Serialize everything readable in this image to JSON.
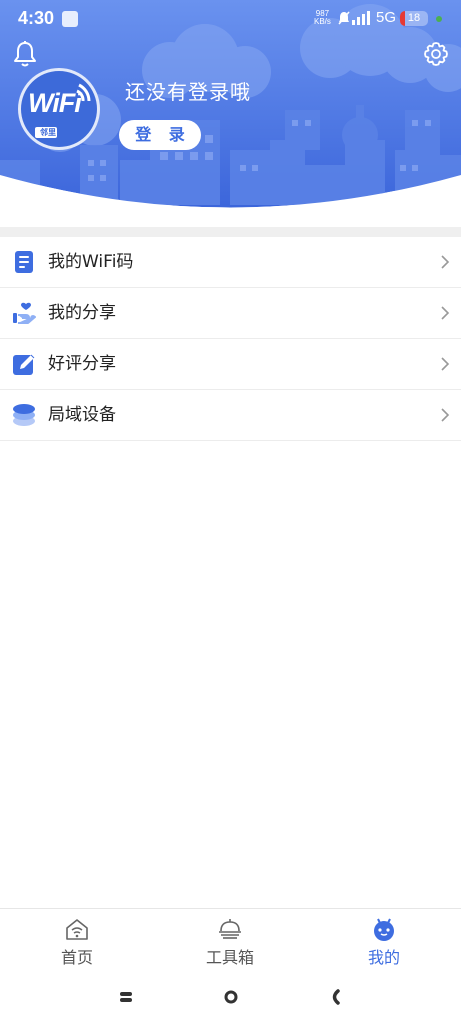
{
  "status_bar": {
    "time": "4:30",
    "speed_value": "987",
    "speed_unit": "KB/s",
    "network": "5G",
    "battery": "18",
    "battery_level": 0.18
  },
  "profile": {
    "logo_text": "WiFi",
    "logo_sub": "邻里",
    "prompt": "还没有登录哦",
    "login_label": "登 录"
  },
  "menu": {
    "items": [
      {
        "label": "我的WiFi码",
        "icon": "document-icon"
      },
      {
        "label": "我的分享",
        "icon": "hand-heart-icon"
      },
      {
        "label": "好评分享",
        "icon": "edit-icon"
      },
      {
        "label": "局域设备",
        "icon": "layers-icon"
      }
    ]
  },
  "tabbar": {
    "tabs": [
      {
        "label": "首页",
        "icon": "home-wifi-icon",
        "active": false
      },
      {
        "label": "工具箱",
        "icon": "toolbox-icon",
        "active": false
      },
      {
        "label": "我的",
        "icon": "robot-icon",
        "active": true
      }
    ]
  },
  "colors": {
    "accent": "#3e6de0",
    "header_gradient_top": "#5b86ea",
    "header_gradient_bottom": "#3d68dc",
    "text": "#222222",
    "tab_inactive": "#555555"
  }
}
